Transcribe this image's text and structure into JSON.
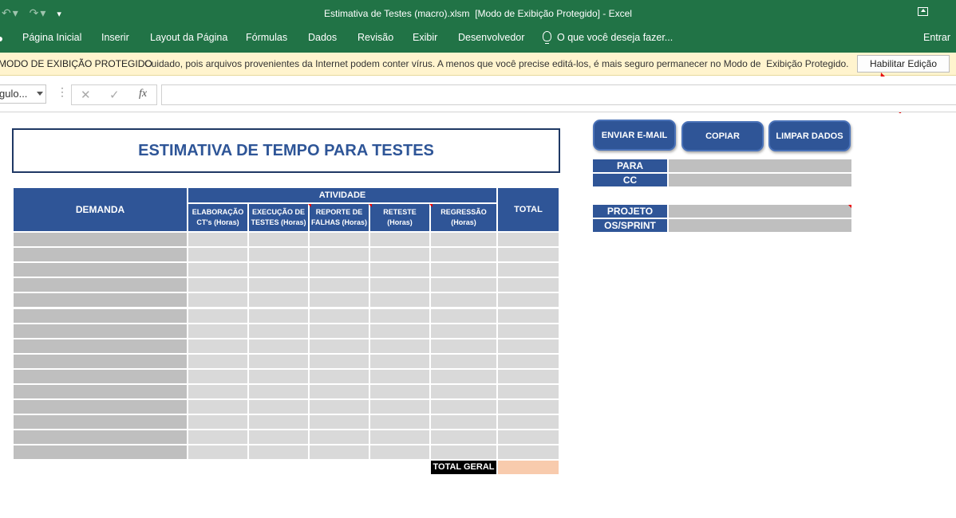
{
  "window": {
    "title": "Estimativa de Testes (macro).xlsm  [Modo de Exibição Protegido] - Excel"
  },
  "ribbon": {
    "tabs": [
      "Página Inicial",
      "Inserir",
      "Layout da Página",
      "Fórmulas",
      "Dados",
      "Revisão",
      "Exibir",
      "Desenvolvedor"
    ],
    "tell_me": "O que você deseja fazer...",
    "signin": "Entrar"
  },
  "protected_bar": {
    "title": "MODO DE EXIBIÇÃO PROTEGIDO",
    "message": "Cuidado, pois arquivos provenientes da Internet podem conter vírus. A menos que você precise editá-los, é mais seguro permanecer no Modo de  Exibição Protegido.",
    "enable_button": "Habilitar Edição"
  },
  "formula_bar": {
    "name_box": "gulo...",
    "cancel": "✕",
    "enter": "✓",
    "fx": "fx",
    "formula": ""
  },
  "sheet": {
    "title": "ESTIMATIVA DE TEMPO PARA TESTES",
    "table": {
      "demanda_header": "DEMANDA",
      "atividade_header": "ATIVIDADE",
      "total_header": "TOTAL",
      "sub_headers": [
        "ELABORAÇÃO CT's (Horas)",
        "EXECUÇÃO DE TESTES (Horas)",
        "REPORTE DE FALHAS (Horas)",
        "RETESTE (Horas)",
        "REGRESSÃO (Horas)"
      ],
      "total_geral_label": "TOTAL GERAL"
    },
    "buttons": {
      "email": "ENVIAR E-MAIL",
      "copy": "COPIAR",
      "clear": "LIMPAR DADOS"
    },
    "email_fields": {
      "para": "PARA",
      "cc": "CC",
      "projeto": "PROJETO",
      "os_sprint": "OS/SPRINT"
    }
  },
  "colors": {
    "excel_green": "#217346",
    "header_blue": "#2f5597",
    "title_blue": "#2e5597",
    "message_bar": "#fff4ce",
    "total_geral_value": "#f8cbad"
  }
}
